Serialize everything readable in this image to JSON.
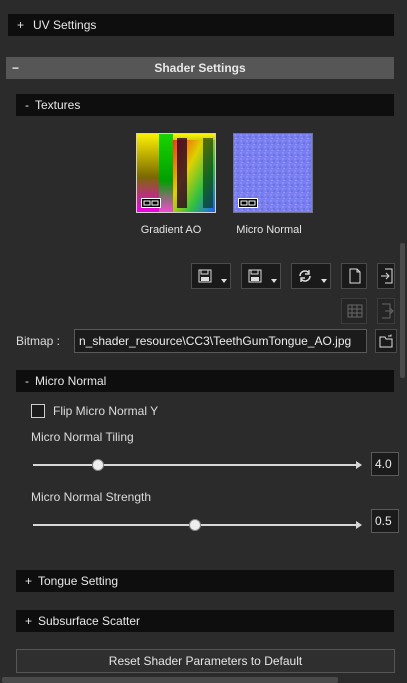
{
  "panels": {
    "uv_settings": {
      "symbol": "+",
      "label": "UV Settings"
    },
    "shader_settings": {
      "symbol": "−",
      "label": "Shader Settings"
    },
    "textures": {
      "symbol": "-",
      "label": "Textures"
    },
    "micro_normal": {
      "symbol": "-",
      "label": "Micro Normal"
    },
    "tongue_setting": {
      "symbol": "+",
      "label": "Tongue Setting"
    },
    "subsurface_scatter": {
      "symbol": "+",
      "label": "Subsurface Scatter"
    }
  },
  "textures": {
    "slots": [
      {
        "caption": "Gradient AO",
        "icon": "gradient-ao-texture-thumbnail"
      },
      {
        "caption": "Micro Normal",
        "icon": "micro-normal-texture-thumbnail"
      }
    ]
  },
  "bitmap": {
    "label": "Bitmap :",
    "path": "n_shader_resource\\CC3\\TeethGumTongue_AO.jpg"
  },
  "micro_normal": {
    "flip_label": "Flip Micro Normal Y",
    "flip_checked": false,
    "tiling_label": "Micro Normal Tiling",
    "tiling_value": "4.0",
    "tiling_fraction": 0.2,
    "strength_label": "Micro Normal Strength",
    "strength_value": "0.5",
    "strength_fraction": 0.5
  },
  "reset_button": "Reset Shader Parameters to Default",
  "colors": {
    "panel_bg": "#2b2b2b",
    "header_dark": "#0e0e0e",
    "header_light": "#565656",
    "micro_normal_tint": "#7c80ee"
  }
}
